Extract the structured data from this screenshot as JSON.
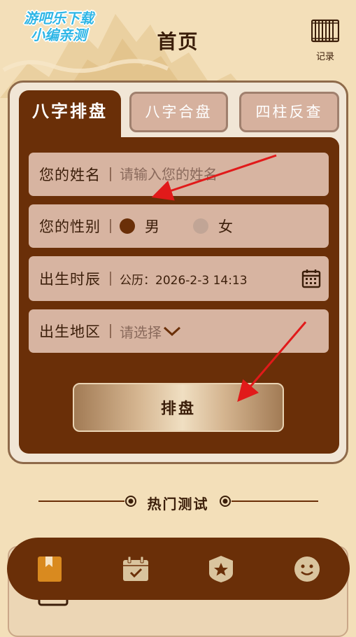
{
  "watermark": {
    "line1": "游吧乐下载",
    "line2": "小编亲测"
  },
  "header": {
    "title": "首页",
    "record_label": "记录"
  },
  "tabs": [
    {
      "label": "八字排盘",
      "active": true
    },
    {
      "label": "八字合盘",
      "active": false
    },
    {
      "label": "四柱反查",
      "active": false
    }
  ],
  "form": {
    "name": {
      "label": "您的姓名",
      "placeholder": "请输入您的姓名",
      "value": ""
    },
    "gender": {
      "label": "您的性别",
      "options": [
        {
          "label": "男",
          "selected": true
        },
        {
          "label": "女",
          "selected": false
        }
      ]
    },
    "birth_time": {
      "label": "出生时辰",
      "value": "公历：2026-2-3 14:13"
    },
    "birth_place": {
      "label": "出生地区",
      "placeholder": "请选择"
    },
    "submit_label": "排盘"
  },
  "hot": {
    "title": "热门测试"
  },
  "bottom_nav": [
    {
      "icon": "bookmark-icon",
      "active": true
    },
    {
      "icon": "calendar-check-icon",
      "active": false
    },
    {
      "icon": "star-badge-icon",
      "active": false
    },
    {
      "icon": "smiley-icon",
      "active": false
    }
  ],
  "colors": {
    "background": "#f3dfb9",
    "primary_brown": "#6a2f08",
    "field_bg": "#d7b4a1",
    "nav_active": "#d98a1f",
    "nav_inactive": "#d9c49e",
    "annotation_red": "#e11a1a"
  }
}
